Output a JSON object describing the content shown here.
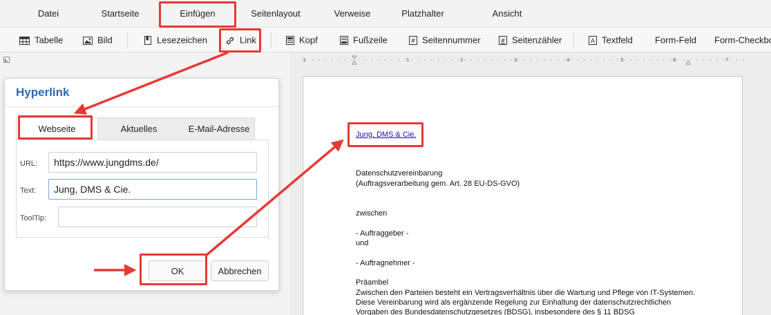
{
  "menubar": {
    "items": [
      "Datei",
      "Startseite",
      "Einfügen",
      "Seitenlayout",
      "Verweise",
      "Platzhalter",
      "Ansicht"
    ],
    "active": "Einfügen"
  },
  "ribbon": {
    "tabelle": "Tabelle",
    "bild": "Bild",
    "lesezeichen": "Lesezeichen",
    "link": "Link",
    "kopf": "Kopf",
    "fusszeile": "Fußzeile",
    "seitennummer": "Seitennummer",
    "seitenzaehler": "Seitenzähler",
    "textfeld": "Textfeld",
    "formfeld": "Form-Feld",
    "formcheckbox": "Form-Checkbox"
  },
  "dialog": {
    "title": "Hyperlink",
    "tabs": [
      "Webseite",
      "Aktuelles Dokument",
      "E-Mail-Adresse"
    ],
    "active_tab": "Webseite",
    "url_label": "URL:",
    "url_value": "https://www.jungdms.de/",
    "text_label": "Text:",
    "text_value": "Jung, DMS & Cie.",
    "tooltip_label": "ToolTip:",
    "tooltip_value": "",
    "ok_label": "OK",
    "cancel_label": "Abbrechen"
  },
  "ruler": {
    "numbers": [
      "1",
      "1",
      "2",
      "3",
      "4",
      "5",
      "6",
      "7"
    ]
  },
  "document": {
    "link_text": "Jung, DMS & Cie.",
    "lines": [
      "Datenschutzvereinbarung",
      "(Auftragsverarbeitung gem. Art. 28 EU-DS-GVO)",
      "zwischen",
      "- Auftraggeber -",
      "und",
      "- Auftragnehmer -",
      "Präambel",
      "Zwischen den Parteien besteht ein Vertragsverhältnis über die Wartung und Pflege von IT-Systemen.",
      "Diese Vereinbarung wird als ergänzende Regelung zur Einhaltung der datenschutzrechtlichen",
      "Vorgaben des Bundesdatenschutzgesetzes (BDSG), insbesondere des § 11 BDSG"
    ]
  },
  "colors": {
    "accent": "#2b6cb0",
    "highlight": "#e53935",
    "link": "#1a0dab"
  }
}
